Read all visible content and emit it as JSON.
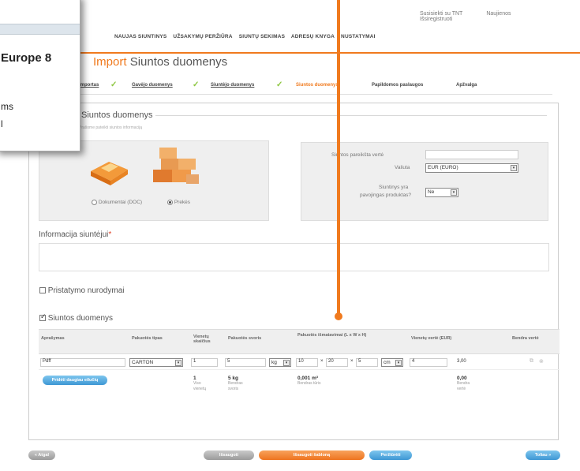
{
  "header": {
    "links": [
      "Susisiekti su TNT",
      "Naujienos",
      "Išsiregistruoti"
    ],
    "nav": [
      "NAUJAS SIUNTINYS",
      "UŽSAKYMŲ PERŽIŪRA",
      "SIUNTŲ SEKIMAS",
      "ADRESŲ KNYGA",
      "NUSTATYMAI"
    ]
  },
  "page": {
    "brand": "Import",
    "title": "Siuntos duomenys"
  },
  "steps": [
    "Importas",
    "Gavėjo duomenys",
    "Siuntėjo duomenys",
    "Siuntos duomenys",
    "Papildomos paslaugos",
    "Apžvalga"
  ],
  "section": {
    "title": "Siuntos duomenys",
    "subtitle": "Prašome pateikti siuntos informaciją"
  },
  "type_choice": {
    "documents": "Dokumentai (DOC)",
    "goods": "Prekės",
    "selected": "goods"
  },
  "value_box": {
    "value_label": "Siuntos pareikšta vertė",
    "currency_label": "Valiuta",
    "currency": "EUR (EURO)",
    "dangerous_label": "Siuntinys yra",
    "dangerous_label2": "pavojingas produktas?",
    "dangerous_value": "Ne"
  },
  "info": {
    "label": "Informacija siuntėjui",
    "required": "*"
  },
  "delivery": {
    "label": "Pristatymo nurodymai",
    "checked": false
  },
  "shipment": {
    "label": "Siuntos duomenys",
    "checked": true
  },
  "table": {
    "headers": [
      "Aprašymas",
      "Pakuotės tipas",
      "Vienetų skaičius",
      "Pakuotės svoris",
      "Pakuotės išmatavimai (L x W x H)",
      "Vienetų vertė (EUR)",
      "Bendra vertė"
    ],
    "row": {
      "description": "Pdff",
      "pkg_type": "CARTON",
      "units": "1",
      "weight": "5",
      "weight_unit": "kg",
      "dim_l": "10",
      "dim_w": "20",
      "dim_h": "5",
      "dim_unit": "cm",
      "unit_value": "4",
      "total_value": "3,00"
    },
    "totals": {
      "units": "1",
      "units_label": "Viso vienetų",
      "weight": "5 kg",
      "weight_label": "Bendras svoris",
      "volume": "0,001 m³",
      "volume_label": "Bendras tūris",
      "value": "0,00",
      "value_label": "Bendra vertė"
    },
    "add_button": "Pridėti daugiau eilučių"
  },
  "footer": {
    "back": "« Atgal",
    "save": "Išsaugoti",
    "save_as": "Išsaugoti šabloną",
    "preview": "Peržiūrėti",
    "next": "Toliau »"
  },
  "popup": {
    "line1": "Europe 8",
    "line2": "ms",
    "line3": "l"
  },
  "colors": {
    "accent": "#f07a1e",
    "check": "#8cc63f",
    "button_blue": "#3e97d4"
  }
}
